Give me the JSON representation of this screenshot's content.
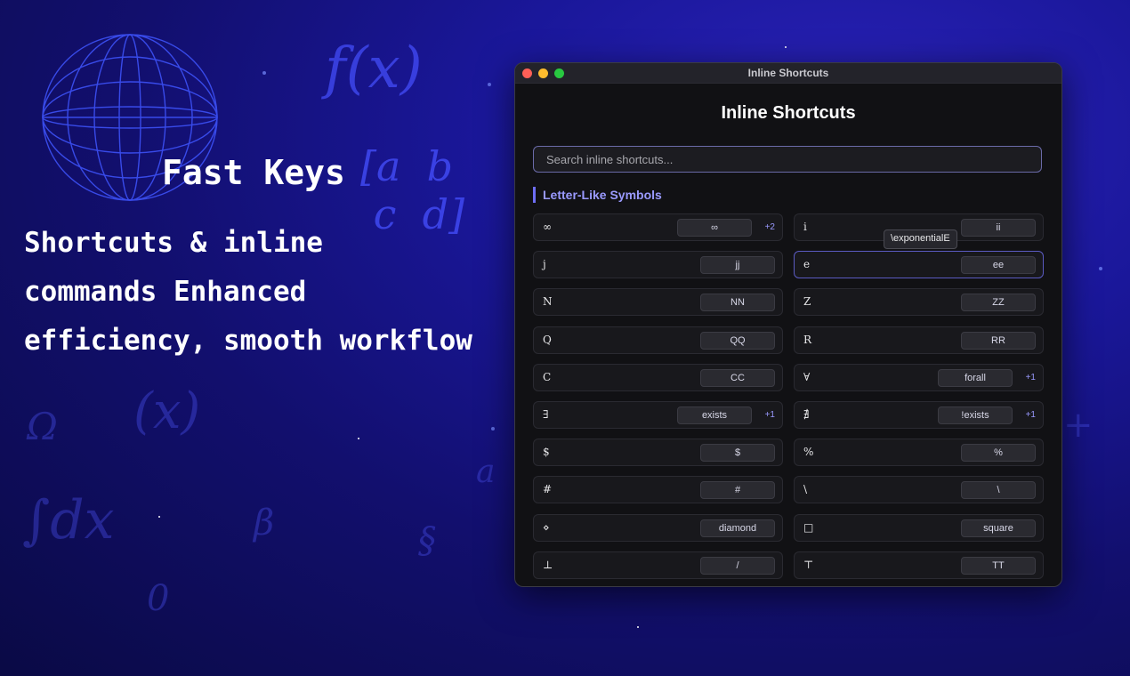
{
  "promo": {
    "headline": "Fast Keys",
    "subline_1": "Shortcuts & inline",
    "subline_2": "commands Enhanced",
    "subline_3": "efficiency, smooth workflow"
  },
  "window": {
    "title_bar": "Inline Shortcuts",
    "heading": "Inline Shortcuts",
    "search_placeholder": "Search inline shortcuts...",
    "section_title": "Letter-Like Symbols",
    "tooltip": "\\exponentialE"
  },
  "shortcuts": [
    {
      "symbol": "∞",
      "keys": "∞",
      "more": "+2"
    },
    {
      "symbol": "i",
      "keys": "ii",
      "more": ""
    },
    {
      "symbol": "j",
      "keys": "jj",
      "more": ""
    },
    {
      "symbol": "e",
      "keys": "ee",
      "more": ""
    },
    {
      "symbol": "N",
      "keys": "NN",
      "more": ""
    },
    {
      "symbol": "Z",
      "keys": "ZZ",
      "more": ""
    },
    {
      "symbol": "Q",
      "keys": "QQ",
      "more": ""
    },
    {
      "symbol": "R",
      "keys": "RR",
      "more": ""
    },
    {
      "symbol": "C",
      "keys": "CC",
      "more": ""
    },
    {
      "symbol": "∀",
      "keys": "forall",
      "more": "+1"
    },
    {
      "symbol": "∃",
      "keys": "exists",
      "more": "+1"
    },
    {
      "symbol": "∄",
      "keys": "!exists",
      "more": "+1"
    },
    {
      "symbol": "$",
      "keys": "$",
      "more": ""
    },
    {
      "symbol": "%",
      "keys": "%",
      "more": ""
    },
    {
      "symbol": "#",
      "keys": "#",
      "more": ""
    },
    {
      "symbol": "\\",
      "keys": "\\",
      "more": ""
    },
    {
      "symbol": "⋄",
      "keys": "diamond",
      "more": ""
    },
    {
      "symbol": "□",
      "keys": "square",
      "more": ""
    },
    {
      "symbol": "⊥",
      "keys": "/",
      "more": ""
    },
    {
      "symbol": "⊤",
      "keys": "TT",
      "more": ""
    }
  ],
  "colors": {
    "accent": "#9a9aff",
    "background": "#1a179a",
    "window": "#111114"
  },
  "icons": [
    "close-icon",
    "minimize-icon",
    "zoom-icon",
    "globe-icon"
  ]
}
